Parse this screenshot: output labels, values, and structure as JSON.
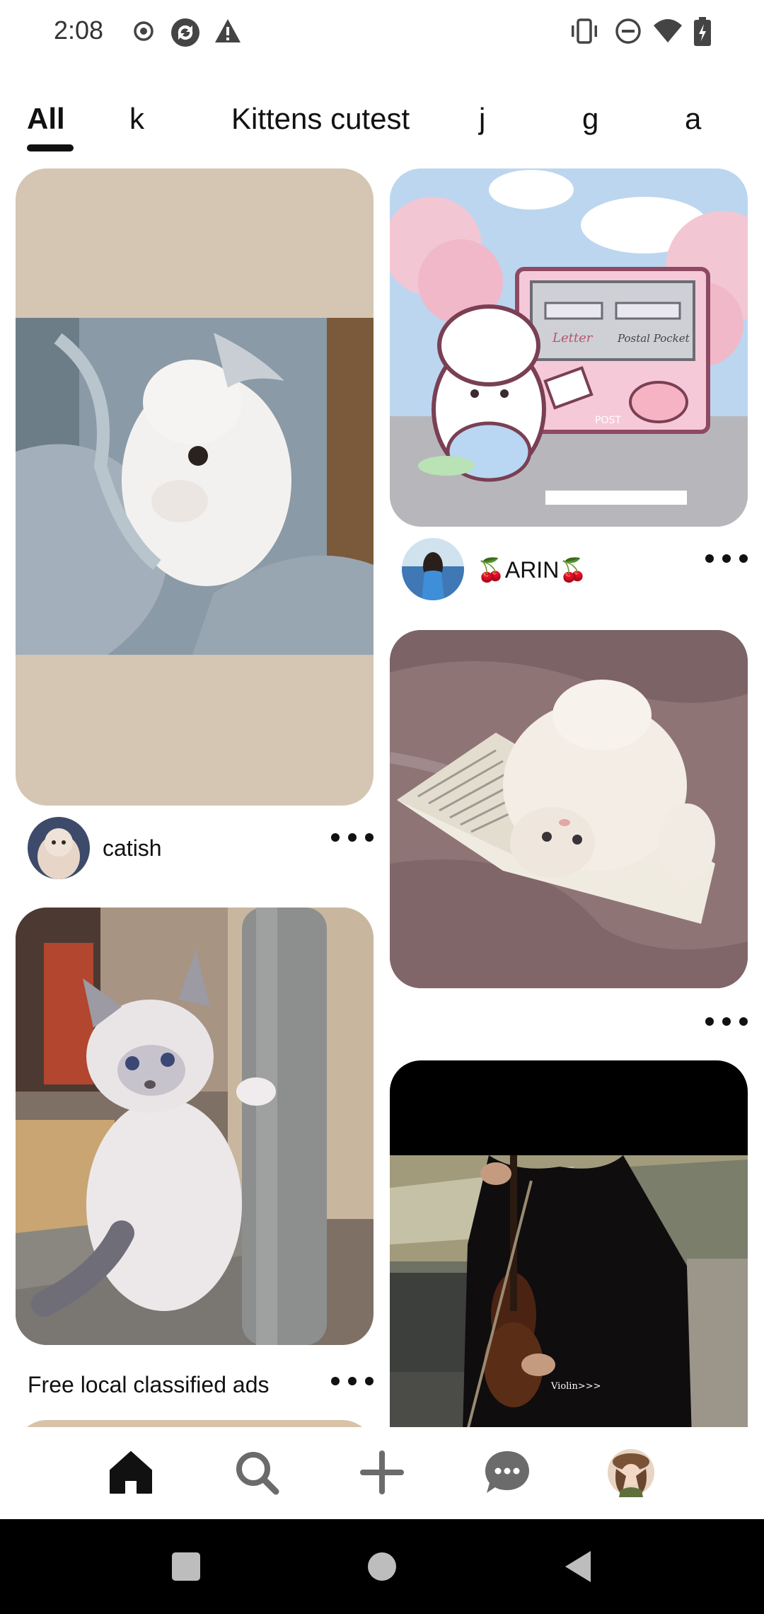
{
  "status_bar": {
    "time": "2:08",
    "left_icons": [
      "record-icon",
      "sync-app-icon",
      "warning-icon"
    ],
    "right_icons": [
      "vibrate-icon",
      "do-not-disturb-icon",
      "wifi-icon",
      "battery-charging-icon"
    ]
  },
  "tabs": [
    {
      "label": "All",
      "active": true
    },
    {
      "label": "k",
      "active": false
    },
    {
      "label": "Kittens cutest",
      "active": false
    },
    {
      "label": "j",
      "active": false
    },
    {
      "label": "g",
      "active": false
    },
    {
      "label": "a",
      "active": false
    }
  ],
  "pins": {
    "white_kitten_blanket": {
      "author": "catish",
      "more_icon": "more-icon"
    },
    "kawaii_mailbox": {
      "author": "🍒ARIN🍒",
      "more_icon": "more-icon",
      "sign_letter": "Letter",
      "sign_postal": "Postal Pocket",
      "sign_post": "POST"
    },
    "fluffy_kitten_book": {
      "more_icon": "more-icon"
    },
    "ragdoll_kitten_post": {
      "caption": "Free local classified ads",
      "more_icon": "more-icon"
    },
    "violin_woman": {
      "overlay_text": "Violin>>>"
    }
  },
  "bottom_nav": {
    "items": [
      "home-icon",
      "search-icon",
      "create-icon",
      "messages-icon",
      "profile-avatar"
    ],
    "active": "home-icon"
  },
  "system_nav": [
    "recents-icon",
    "home-circle-icon",
    "back-icon"
  ],
  "colors": {
    "text": "#111111",
    "placeholder_beige": "#d4c6b3",
    "system_bar": "#000000"
  }
}
